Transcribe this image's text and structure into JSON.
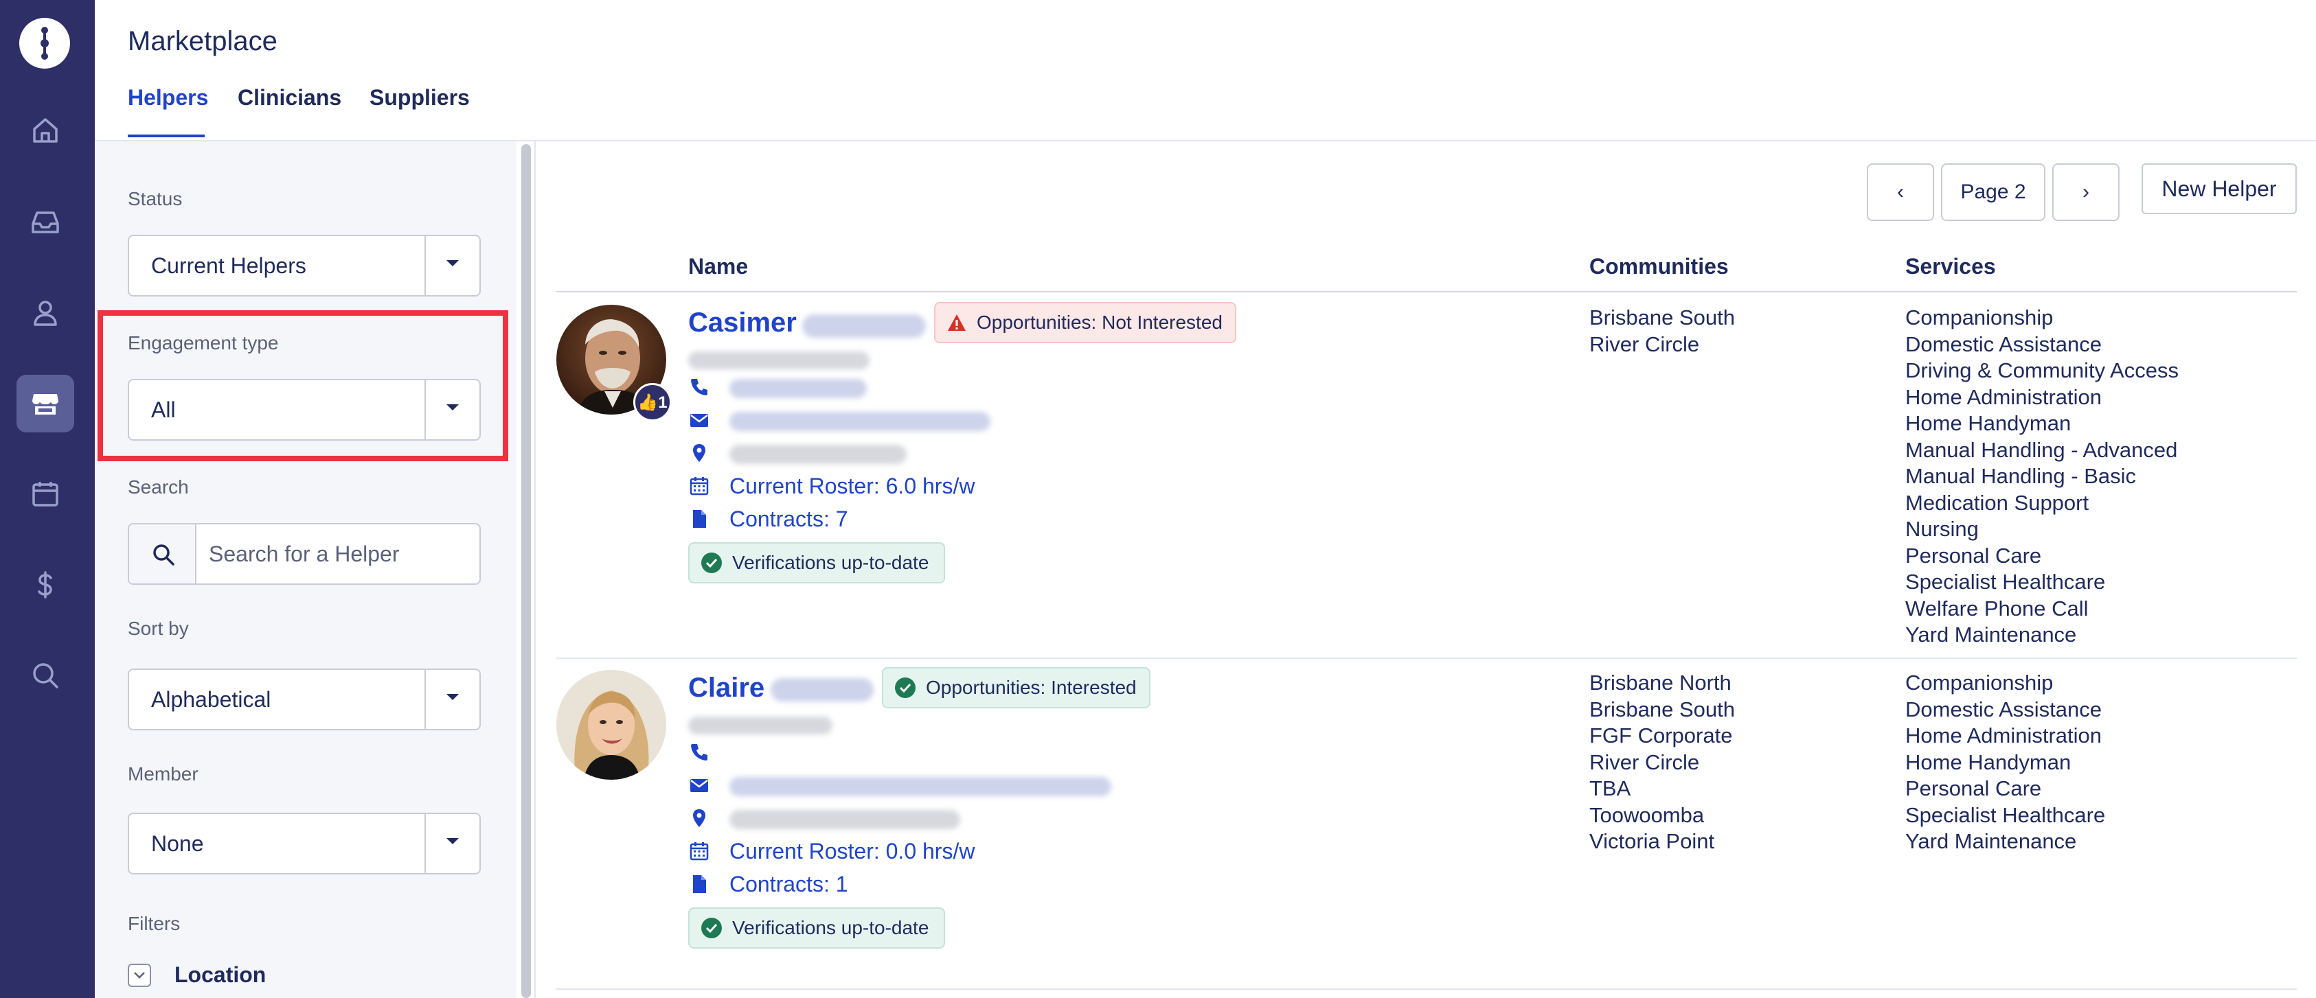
{
  "app": {
    "title": "Marketplace"
  },
  "tabs": [
    {
      "label": "Helpers",
      "active": true
    },
    {
      "label": "Clinicians",
      "active": false
    },
    {
      "label": "Suppliers",
      "active": false
    }
  ],
  "nav_icons": [
    "logo-icon",
    "home-icon",
    "inbox-icon",
    "person-icon",
    "store-icon",
    "calendar-icon",
    "dollar-icon",
    "search-icon"
  ],
  "filters": {
    "status": {
      "label": "Status",
      "value": "Current Helpers"
    },
    "engagement": {
      "label": "Engagement type",
      "value": "All"
    },
    "search": {
      "label": "Search",
      "placeholder": "Search for a Helper"
    },
    "sort": {
      "label": "Sort by",
      "value": "Alphabetical"
    },
    "member": {
      "label": "Member",
      "value": "None"
    },
    "filters_label": "Filters",
    "location_label": "Location"
  },
  "pager": {
    "prev": "‹",
    "page": "Page 2",
    "next": "›"
  },
  "new_helper_label": "New Helper",
  "columns": {
    "name": "Name",
    "communities": "Communities",
    "services": "Services"
  },
  "helpers": [
    {
      "first_name": "Casimer",
      "likes": "👍1",
      "opportunity": "Opportunities: Not Interested",
      "opportunity_status": "warning",
      "roster": "Current Roster: 6.0 hrs/w",
      "contracts": "Contracts: 7",
      "verification": "Verifications up-to-date",
      "communities": [
        "Brisbane South",
        "River Circle"
      ],
      "services": [
        "Companionship",
        "Domestic Assistance",
        "Driving & Community Access",
        "Home Administration",
        "Home Handyman",
        "Manual Handling - Advanced",
        "Manual Handling - Basic",
        "Medication Support",
        "Nursing",
        "Personal Care",
        "Specialist Healthcare",
        "Welfare Phone Call",
        "Yard Maintenance"
      ]
    },
    {
      "first_name": "Claire",
      "opportunity": "Opportunities: Interested",
      "opportunity_status": "ok",
      "roster": "Current Roster: 0.0 hrs/w",
      "contracts": "Contracts: 1",
      "verification": "Verifications up-to-date",
      "communities": [
        "Brisbane North",
        "Brisbane South",
        "FGF Corporate",
        "River Circle",
        "TBA",
        "Toowoomba",
        "Victoria Point"
      ],
      "services": [
        "Companionship",
        "Domestic Assistance",
        "Home Administration",
        "Home Handyman",
        "Personal Care",
        "Specialist Healthcare",
        "Yard Maintenance"
      ]
    }
  ],
  "colors": {
    "rail": "#2d2f66",
    "accent": "#1f44c8",
    "highlight": "#ee3140",
    "success": "#1e7a55",
    "danger": "#d93025"
  }
}
